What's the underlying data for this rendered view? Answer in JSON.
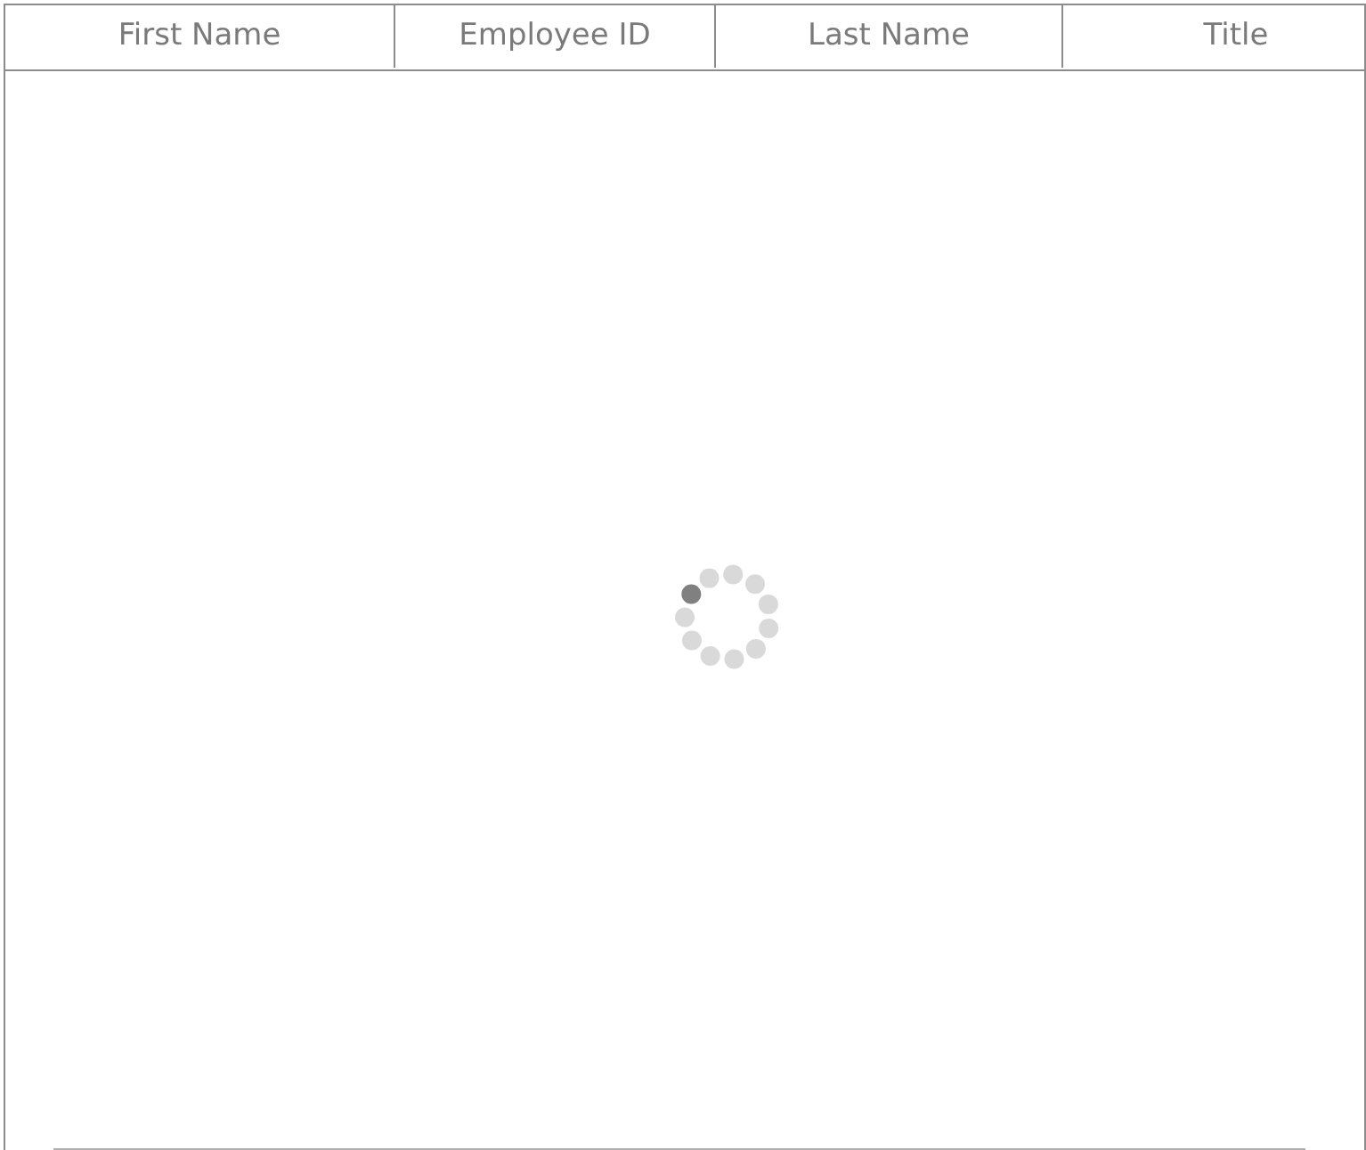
{
  "grid": {
    "columns": [
      {
        "label": "First Name"
      },
      {
        "label": "Employee ID"
      },
      {
        "label": "Last Name"
      },
      {
        "label": "Title"
      }
    ],
    "loading": true
  }
}
